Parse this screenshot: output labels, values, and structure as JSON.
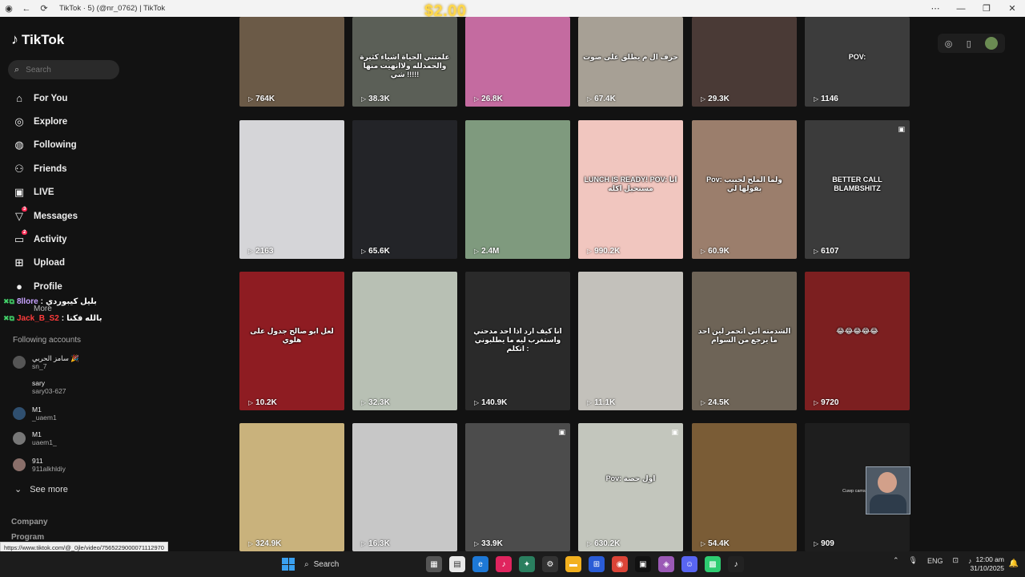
{
  "browser": {
    "tab_title": "TikTok · 5) (@nr_0762) | TikTok",
    "overlay_money": "$2.00",
    "status_url": "https://www.tiktok.com/@_0jle/video/7565229000071112970"
  },
  "sidebar": {
    "logo": "TikTok",
    "search_placeholder": "Search",
    "nav": [
      {
        "label": "For You",
        "icon": "home-icon"
      },
      {
        "label": "Explore",
        "icon": "compass-icon"
      },
      {
        "label": "Following",
        "icon": "following-icon"
      },
      {
        "label": "Friends",
        "icon": "friends-icon"
      },
      {
        "label": "LIVE",
        "icon": "live-icon"
      },
      {
        "label": "Messages",
        "icon": "messages-icon",
        "badge": "3"
      },
      {
        "label": "Activity",
        "icon": "activity-icon",
        "badge": "2"
      },
      {
        "label": "Upload",
        "icon": "upload-icon"
      },
      {
        "label": "Profile",
        "icon": "profile-icon"
      }
    ],
    "more_label": "More",
    "chat": [
      {
        "user": "8llore",
        "msg": "بليل كيبوردي"
      },
      {
        "user": "Jack_B_S2",
        "msg": "بالله فكنا"
      }
    ],
    "following_title": "Following accounts",
    "accounts": [
      {
        "name": "سامز الحربي 🎉",
        "handle": "sn_7"
      },
      {
        "name": "sary",
        "handle": "sary03-627"
      },
      {
        "name": "M1",
        "handle": "_uaem1"
      },
      {
        "name": "M1",
        "handle": "uaem1_"
      },
      {
        "name": "911",
        "handle": "911alkhldiy"
      }
    ],
    "see_more": "See more",
    "footer": [
      "Company",
      "Program"
    ]
  },
  "grid": {
    "rows": [
      [
        {
          "views": "764K",
          "caption": "",
          "color": "#6b5a47"
        },
        {
          "views": "38.3K",
          "caption": "علمتني الحياة اشياء كثيرة والحمدلله ولاانهيت منها شي !!!!!",
          "color": "#5b5f57"
        },
        {
          "views": "26.8K",
          "caption": "",
          "color": "#c46ba0"
        },
        {
          "views": "67.4K",
          "caption": "حرف ال م يطلق على صوت",
          "color": "#a7a095"
        },
        {
          "views": "29.3K",
          "caption": "",
          "color": "#4a3a36"
        },
        {
          "views": "1146",
          "caption": "POV:",
          "color": "#3c3c3c"
        }
      ],
      [
        {
          "views": "2163",
          "caption": "",
          "color": "#d5d5d8"
        },
        {
          "views": "65.6K",
          "caption": "",
          "color": "#232428"
        },
        {
          "views": "2.4M",
          "caption": "",
          "color": "#7f9a7e"
        },
        {
          "views": "990.2K",
          "caption": "LUNCH IS READY! POV: انا مستحيل اكله",
          "color": "#f1c6bf"
        },
        {
          "views": "60.9K",
          "caption": "Pov: ولما الملح لحبيب بقولها لي",
          "color": "#9b7e6c"
        },
        {
          "views": "6107",
          "caption": "BETTER CALL BLAMBSHITZ",
          "color": "#3b3b3b",
          "pin": true
        }
      ],
      [
        {
          "views": "10.2K",
          "caption": "لعل ابو صالح جدول على هلوي",
          "color": "#8e1c22"
        },
        {
          "views": "32.3K",
          "caption": "",
          "color": "#b8c0b4"
        },
        {
          "views": "140.9K",
          "caption": "انا كيف ارد اذا احد مدحني واستغرب ليه ما يطلبوني اتكلم :",
          "color": "#2a2a2a"
        },
        {
          "views": "11.1K",
          "caption": "",
          "color": "#c3c1bb"
        },
        {
          "views": "24.5K",
          "caption": "الشدمته اني اتحمر لين احد ما يرجع من السوام",
          "color": "#6e6457"
        },
        {
          "views": "9720",
          "caption": "😂😂😂😂😂",
          "color": "#7c1f20"
        }
      ],
      [
        {
          "views": "324.9K",
          "caption": "",
          "color": "#c9b27c"
        },
        {
          "views": "16.3K",
          "caption": "",
          "color": "#c7c7c7"
        },
        {
          "views": "33.9K",
          "caption": "",
          "color": "#4c4c4c",
          "pin": true
        },
        {
          "views": "630.2K",
          "caption": "Pov: اول حصة",
          "color": "#c3c6bd",
          "pin": true
        },
        {
          "views": "54.4K",
          "caption": "",
          "color": "#7a5c36"
        },
        {
          "views": "909",
          "caption": "",
          "color": "#1e1e1e"
        }
      ]
    ]
  },
  "webcam_label": "Cuwp cams",
  "taskbar": {
    "search": "Search",
    "lang": "ENG",
    "time": "12:00 am",
    "date": "31/10/2025"
  }
}
